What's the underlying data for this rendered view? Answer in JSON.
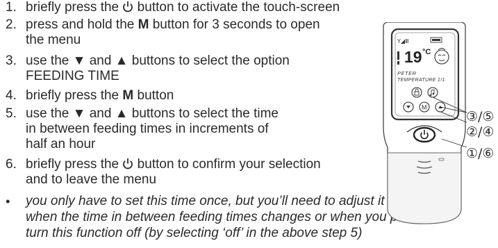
{
  "steps": [
    {
      "num": "1.",
      "pre": "briefly press the ",
      "icon": "power-icon",
      "post": " button to activate the touch-screen"
    },
    {
      "num": "2.",
      "pre": "press and hold the ",
      "bold": "M",
      "post": " button for 3 seconds to open",
      "cont": "the menu"
    },
    {
      "num": "3.",
      "pre": "use the ▼ and ▲ buttons to select the option",
      "cont": "FEEDING TIME"
    },
    {
      "num": "4.",
      "pre": "briefly press the ",
      "bold": "M",
      "post": " button"
    },
    {
      "num": "5.",
      "pre": "use the ▼ and ▲ buttons to select the time",
      "cont": "in between feeding times in increments of",
      "cont2": "half an hour"
    },
    {
      "num": "6.",
      "pre": "briefly press the ",
      "icon": "power-icon",
      "post": " button to confirm your selection",
      "cont": "and to leave the menu"
    }
  ],
  "note": {
    "bullet": "•",
    "lines": [
      "you only have to set this time once, but you’ll need to adjust it again",
      "when the time in between feeding times changes or when you prefer to",
      "turn this function off (by selecting ‘off’ in the above step 5)"
    ]
  },
  "device": {
    "screen_temp": "19",
    "screen_temp_unit": "°C",
    "screen_name": "PETER",
    "screen_label": "TEMPERATURE 1!1",
    "btn_m": "M",
    "callouts": [
      "③/⑤",
      "②/④",
      "①/⑥"
    ]
  }
}
